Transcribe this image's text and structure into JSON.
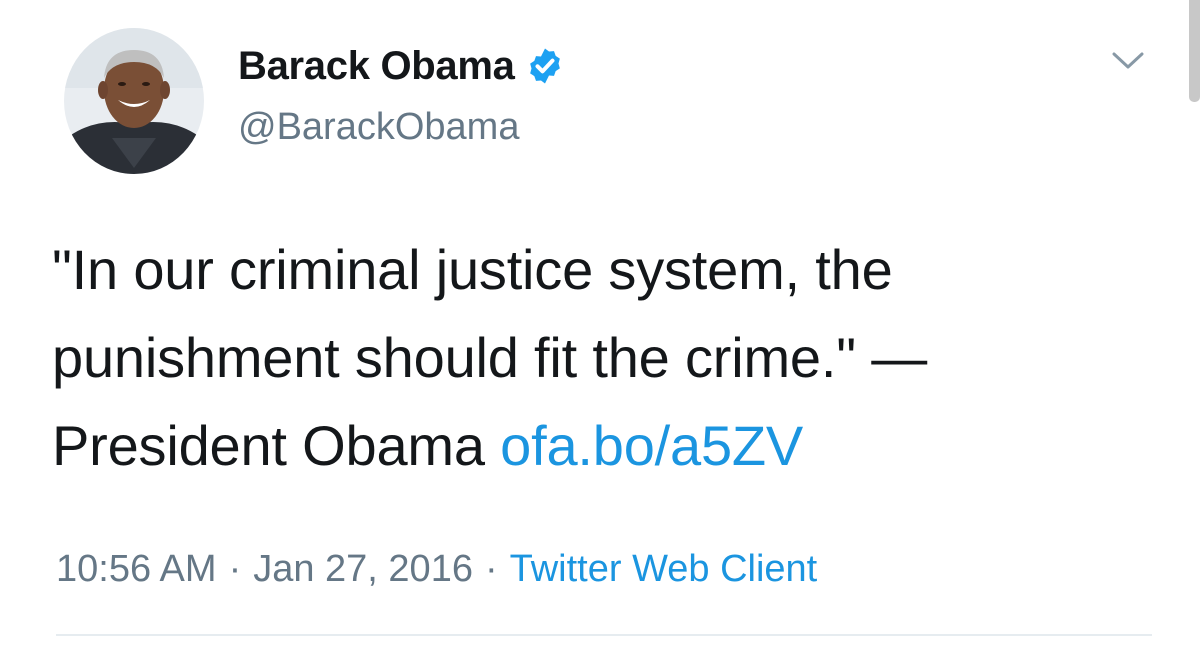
{
  "author": {
    "display_name": "Barack Obama",
    "handle": "@BarackObama",
    "verified_icon": "verified-badge-icon",
    "avatar_icon": "avatar-photo"
  },
  "menu_icon": "chevron-down-icon",
  "tweet": {
    "line1": "\"In our criminal justice system, the",
    "line2": "punishment should fit the crime.\" —",
    "line3_text": "President Obama ",
    "link_text": "ofa.bo/a5ZV"
  },
  "meta": {
    "time": "10:56 AM",
    "separator": "·",
    "date": "Jan 27, 2016",
    "source": "Twitter Web Client"
  },
  "colors": {
    "text": "#14171a",
    "secondary": "#657786",
    "link": "#1b95e0",
    "verified": "#1da1f2",
    "divider": "#e6ecf0"
  }
}
